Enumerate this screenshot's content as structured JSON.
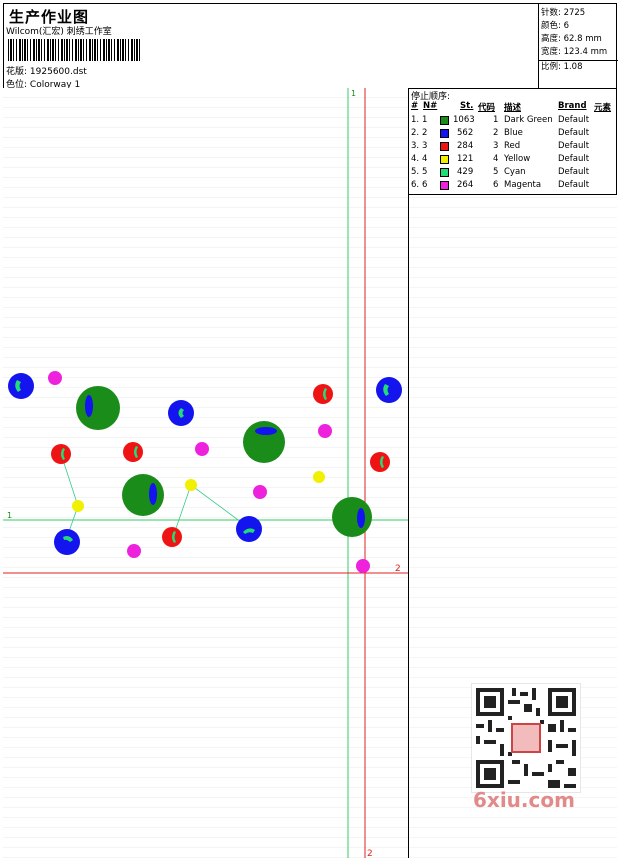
{
  "header": {
    "title": "生产作业图",
    "subtitle": "Wilcom(汇宏) 刺绣工作室",
    "design_label": "花版:",
    "design_value": "1925600.dst",
    "colorway_label": "色位:",
    "colorway_value": "Colorway 1"
  },
  "stats": {
    "stitches": "针数: 2725",
    "colors": "颜色: 6",
    "height": "高度: 62.8 mm",
    "width": "宽度: 123.4 mm",
    "scale": "比例: 1.08"
  },
  "stop_sequence": {
    "title": "停止顺序:",
    "headers": {
      "hash": "#",
      "n": "N#",
      "st": "St.",
      "code": "代码",
      "desc": "描述",
      "brand": "Brand",
      "element": "元素"
    },
    "rows": [
      {
        "idx": "1.",
        "n": "1",
        "color": "#1a8c1a",
        "st": "1063",
        "code": "1",
        "desc": "Dark Green",
        "brand": "Default"
      },
      {
        "idx": "2.",
        "n": "2",
        "color": "#1414ee",
        "st": "562",
        "code": "2",
        "desc": "Blue",
        "brand": "Default"
      },
      {
        "idx": "3.",
        "n": "3",
        "color": "#ee1414",
        "st": "284",
        "code": "3",
        "desc": "Red",
        "brand": "Default"
      },
      {
        "idx": "4.",
        "n": "4",
        "color": "#f0f000",
        "st": "121",
        "code": "4",
        "desc": "Yellow",
        "brand": "Default"
      },
      {
        "idx": "5.",
        "n": "5",
        "color": "#22dd77",
        "st": "429",
        "code": "5",
        "desc": "Cyan",
        "brand": "Default"
      },
      {
        "idx": "6.",
        "n": "6",
        "color": "#ee22dd",
        "st": "264",
        "code": "6",
        "desc": "Magenta",
        "brand": "Default"
      }
    ]
  },
  "guides": {
    "v1_label": "1",
    "h1_label": "1",
    "h2_label": "2",
    "v2_label": "2"
  },
  "watermark": "6xiu.com"
}
